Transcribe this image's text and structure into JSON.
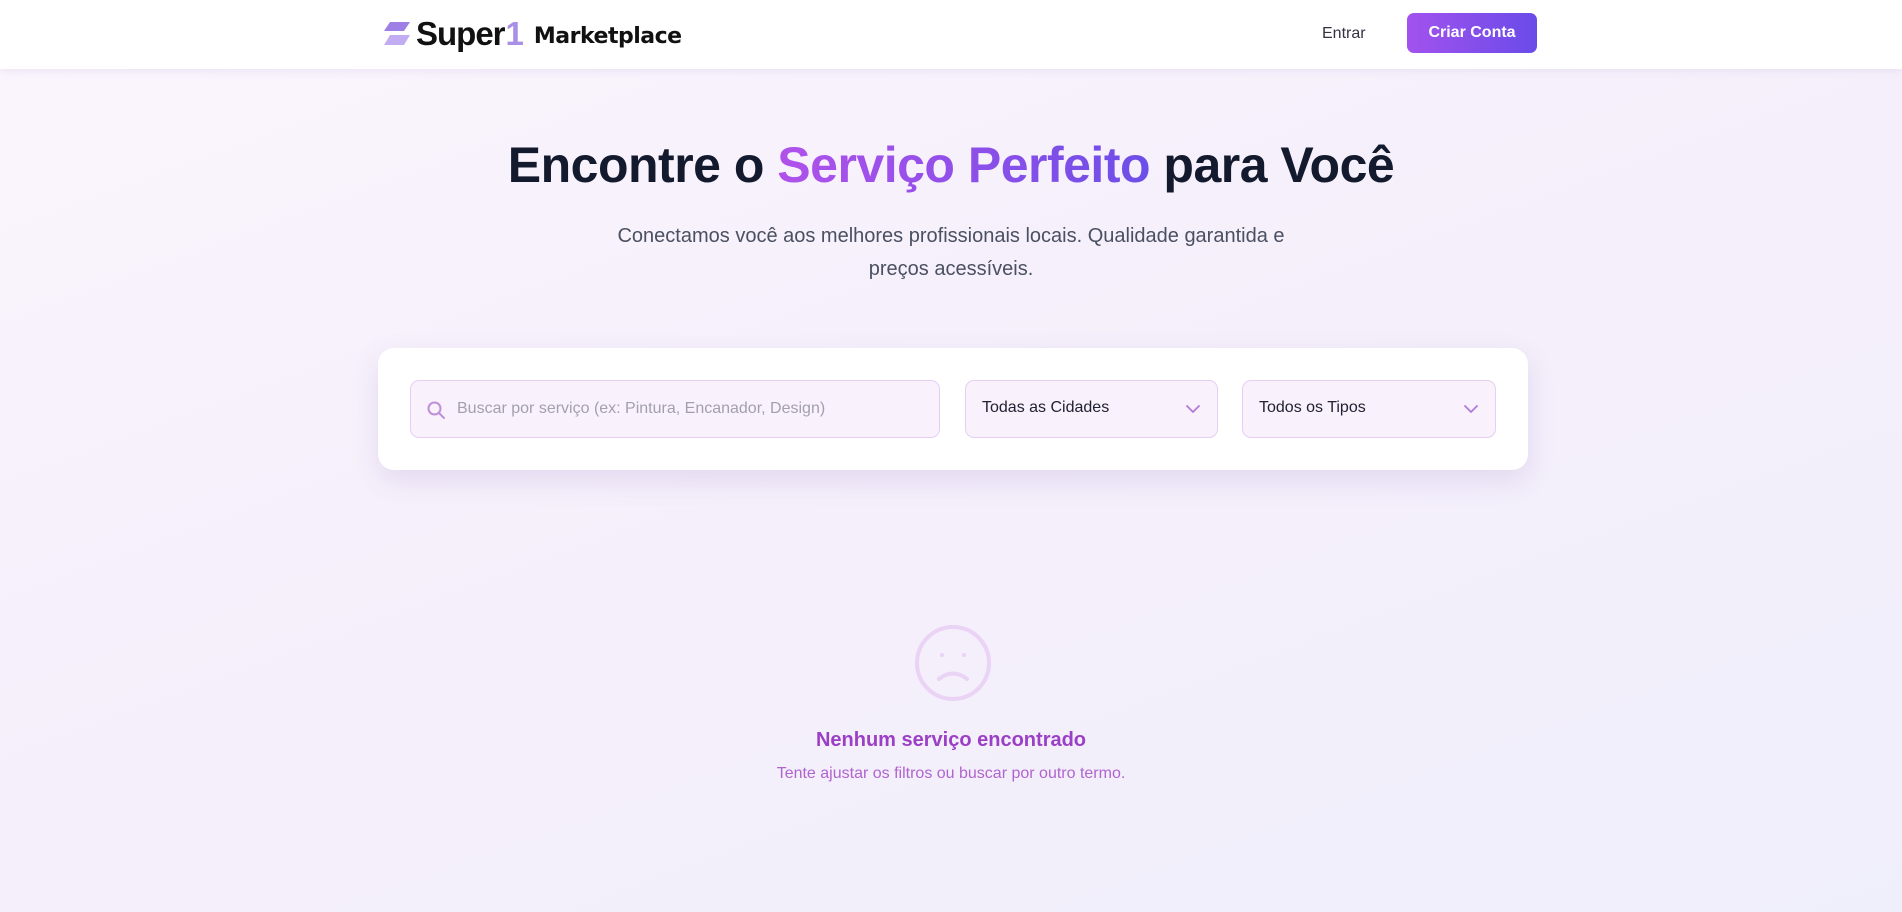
{
  "header": {
    "logo_super": "Super",
    "logo_one": "1",
    "logo_marketplace": "Marketplace",
    "login_label": "Entrar",
    "signup_label": "Criar Conta"
  },
  "hero": {
    "title_start": "Encontre o ",
    "title_accent": "Serviço Perfeito",
    "title_end": " para Você",
    "subtitle_line1": "Conectamos você aos melhores profissionais locais. Qualidade garantida e",
    "subtitle_line2": "preços acessíveis."
  },
  "search": {
    "placeholder": "Buscar por serviço (ex: Pintura, Encanador, Design)",
    "value": "",
    "city_selected": "Todas as Cidades",
    "type_selected": "Todos os Tipos"
  },
  "empty_state": {
    "icon": "sad-face-icon",
    "title": "Nenhum serviço encontrado",
    "message": "Tente ajustar os filtros ou buscar por outro termo."
  },
  "colors": {
    "brand_gradient_start": "#a252ee",
    "brand_gradient_end": "#6a4be8",
    "heading": "#141a2e",
    "empty_title": "#9b3fc6",
    "empty_text": "#b064cf",
    "field_bg": "#f9f1fc"
  }
}
